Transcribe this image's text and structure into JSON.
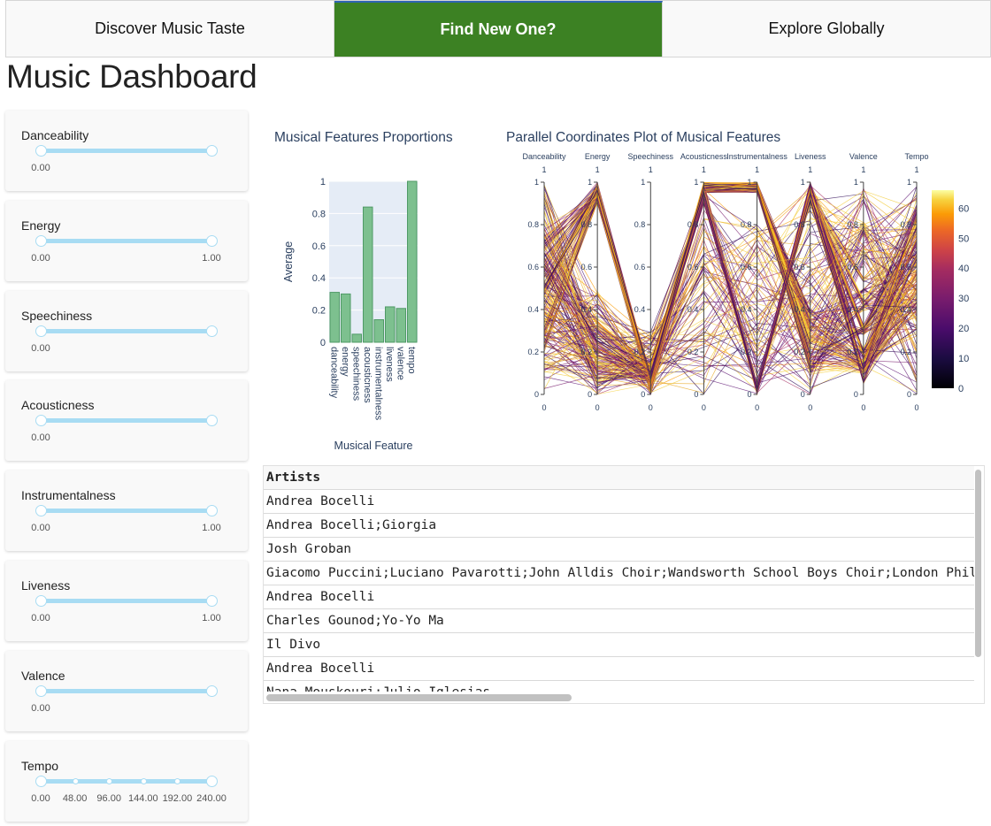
{
  "tabs": [
    {
      "label": "Discover Music Taste",
      "active": false
    },
    {
      "label": "Find New One?",
      "active": true
    },
    {
      "label": "Explore Globally",
      "active": false
    }
  ],
  "page_title": "Music Dashboard",
  "sliders": [
    {
      "label": "Danceability",
      "min": 0,
      "max": 1,
      "value": [
        0,
        1
      ],
      "marks": [
        "0.00"
      ]
    },
    {
      "label": "Energy",
      "min": 0,
      "max": 1,
      "value": [
        0,
        1
      ],
      "marks": [
        "0.00",
        "1.00"
      ]
    },
    {
      "label": "Speechiness",
      "min": 0,
      "max": 1,
      "value": [
        0,
        1
      ],
      "marks": [
        "0.00"
      ]
    },
    {
      "label": "Acousticness",
      "min": 0,
      "max": 1,
      "value": [
        0,
        1
      ],
      "marks": [
        "0.00"
      ]
    },
    {
      "label": "Instrumentalness",
      "min": 0,
      "max": 1,
      "value": [
        0,
        1
      ],
      "marks": [
        "0.00",
        "1.00"
      ]
    },
    {
      "label": "Liveness",
      "min": 0,
      "max": 1,
      "value": [
        0,
        1
      ],
      "marks": [
        "0.00",
        "1.00"
      ]
    },
    {
      "label": "Valence",
      "min": 0,
      "max": 1,
      "value": [
        0,
        1
      ],
      "marks": [
        "0.00"
      ]
    },
    {
      "label": "Tempo",
      "min": 0,
      "max": 240,
      "value": [
        0,
        240
      ],
      "marks": [
        "0.00",
        "48.00",
        "96.00",
        "144.00",
        "192.00",
        "240.00"
      ]
    }
  ],
  "chart_data": [
    {
      "type": "bar",
      "title": "Musical Features Proportions",
      "xlabel": "Musical Feature",
      "ylabel": "Average",
      "categories": [
        "danceability",
        "energy",
        "speechiness",
        "acousticness",
        "instrumentalness",
        "liveness",
        "valence",
        "tempo"
      ],
      "values": [
        0.31,
        0.3,
        0.05,
        0.84,
        0.14,
        0.22,
        0.21,
        1.0
      ],
      "yticks": [
        "0",
        "0.2",
        "0.4",
        "0.6",
        "0.8",
        "1"
      ],
      "ylim": [
        0,
        1
      ],
      "bar_color": "#7dc08f",
      "bar_edge": "#4f9a66",
      "plot_bg": "#e5ecf6"
    },
    {
      "type": "parallel_coordinates",
      "title": "Parallel Coordinates Plot of Musical Features",
      "dimensions": [
        "Danceability",
        "Energy",
        "Speechiness",
        "Acousticness",
        "Instrumentalness",
        "Liveness",
        "Valence",
        "Tempo"
      ],
      "range": [
        0,
        1
      ],
      "ticks": [
        "0",
        "0.2",
        "0.4",
        "0.6",
        "0.8",
        "1"
      ],
      "colorscale": "inferno",
      "colorbar_ticks": [
        "0",
        "10",
        "20",
        "30",
        "40",
        "50",
        "60"
      ],
      "colorbar_range": [
        0,
        66
      ]
    }
  ],
  "table": {
    "header": "Artists",
    "rows": [
      "Andrea Bocelli",
      "Andrea Bocelli;Giorgia",
      "Josh Groban",
      "Giacomo Puccini;Luciano Pavarotti;John Alldis Choir;Wandsworth School Boys Choir;London Phil",
      "Andrea Bocelli",
      "Charles Gounod;Yo-Yo Ma",
      "Il Divo",
      "Andrea Bocelli",
      "Nana Mouskouri;Julio Iglesias"
    ]
  }
}
